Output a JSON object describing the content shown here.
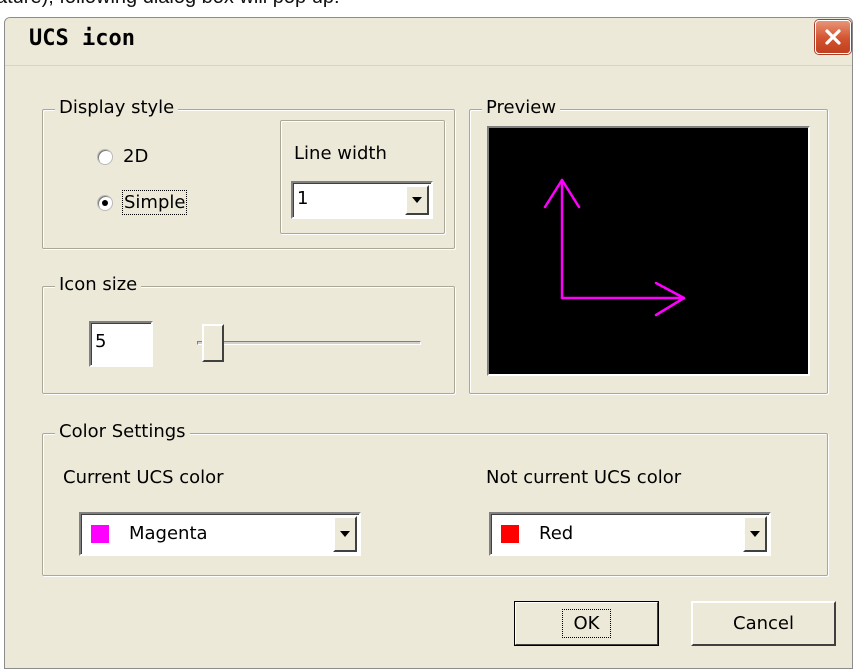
{
  "caption": "ature); following dialog box will pop up:",
  "window": {
    "title": "UCS icon",
    "close_icon": "close-x-icon"
  },
  "display_style": {
    "legend": "Display style",
    "options": [
      {
        "label": "2D",
        "selected": false
      },
      {
        "label": "Simple",
        "selected": true
      }
    ],
    "line_width": {
      "legend": "Line width",
      "value": "1"
    }
  },
  "icon_size": {
    "legend": "Icon size",
    "value": "5",
    "slider_level": 0.07
  },
  "preview": {
    "legend": "Preview",
    "background": "#000000",
    "axis_color": "#ff00ff",
    "icon": "ucs-axes-icon"
  },
  "color_settings": {
    "legend": "Color Settings",
    "current": {
      "label": "Current UCS color",
      "value": "Magenta",
      "swatch": "#ff00ff"
    },
    "not_current": {
      "label": "Not current UCS color",
      "value": "Red",
      "swatch": "#ff0000"
    }
  },
  "buttons": {
    "ok": "OK",
    "cancel": "Cancel"
  }
}
